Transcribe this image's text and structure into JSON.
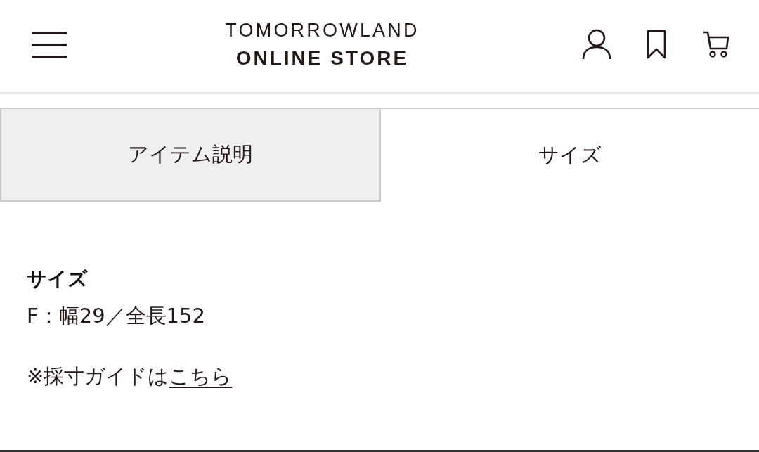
{
  "header": {
    "logo": {
      "line1": "TOMORROWLAND",
      "line2": "ONLINE STORE"
    }
  },
  "tabs": [
    {
      "label": "アイテム説明",
      "selected": false
    },
    {
      "label": "サイズ",
      "selected": true
    }
  ],
  "size_section": {
    "heading": "サイズ",
    "value": "F：幅29／全長152",
    "guide_text": "※採寸ガイドは",
    "guide_link": "こちら"
  }
}
